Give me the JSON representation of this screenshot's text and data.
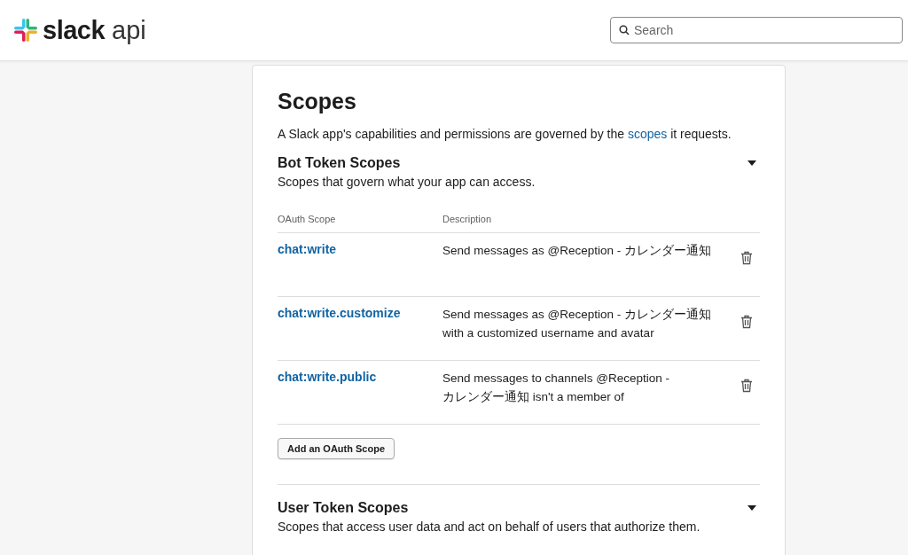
{
  "header": {
    "logo_word": "slack",
    "logo_suffix": "api",
    "search": {
      "placeholder": "Search"
    }
  },
  "page": {
    "title": "Scopes",
    "intro": {
      "before": "A Slack app's capabilities and permissions are governed by the",
      "link": "scopes",
      "after": "it requests."
    },
    "sections": [
      {
        "title": "Bot Token Scopes",
        "subtitle": "Scopes that govern what your app can access.",
        "expanded": true,
        "columns": [
          "OAuth Scope",
          "Description"
        ],
        "rows": [
          {
            "scope": "chat:write",
            "description": "Send messages as @Reception - カレンダー通知"
          },
          {
            "scope": "chat:write.customize",
            "description": "Send messages as @Reception - カレンダー通知 with a customized username and avatar"
          },
          {
            "scope": "chat:write.public",
            "description": "Send messages to channels @Reception - カレンダー通知 isn't a member of"
          }
        ],
        "add_button": "Add an OAuth Scope"
      },
      {
        "title": "User Token Scopes",
        "subtitle": "Scopes that access user data and act on behalf of users that authorize them.",
        "expanded": true
      }
    ]
  }
}
